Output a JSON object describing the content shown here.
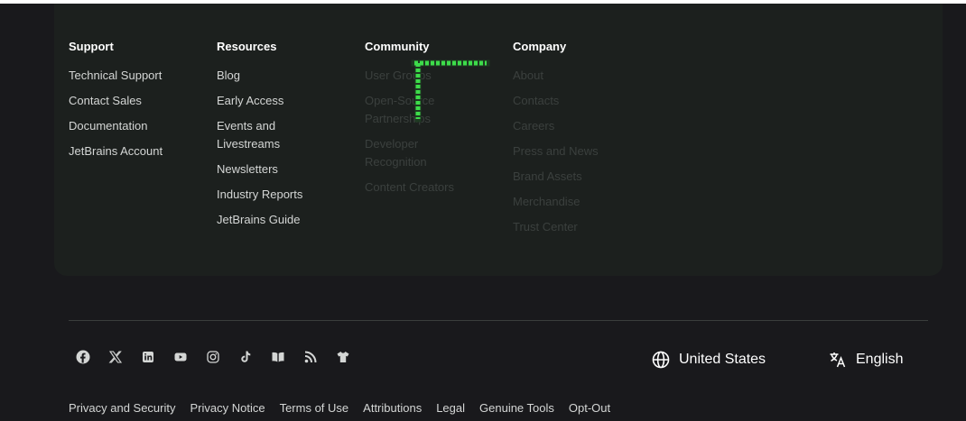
{
  "columns": {
    "support": {
      "title": "Support",
      "links": [
        "Technical Support",
        "Contact Sales",
        "Documentation",
        "JetBrains Account"
      ]
    },
    "resources": {
      "title": "Resources",
      "links": [
        "Blog",
        "Early Access",
        "Events and Livestreams",
        "Newsletters",
        "Industry Reports",
        "JetBrains Guide"
      ]
    },
    "community": {
      "title": "Community",
      "links": [
        "User Groups",
        "Open-Source Partnerships",
        "Developer Recognition",
        "Content Creators"
      ]
    },
    "company": {
      "title": "Company",
      "links": [
        "About",
        "Contacts",
        "Careers",
        "Press and News",
        "Brand Assets",
        "Merchandise",
        "Trust Center"
      ]
    }
  },
  "social_icons": [
    "facebook-icon",
    "x-icon",
    "linkedin-icon",
    "youtube-icon",
    "instagram-icon",
    "tiktok-icon",
    "book-icon",
    "rss-icon",
    "merch-shirt-icon"
  ],
  "region": {
    "label": "United States",
    "icon": "globe-icon"
  },
  "language": {
    "label": "English",
    "icon": "translate-icon"
  },
  "legal_links": [
    "Privacy and Security",
    "Privacy Notice",
    "Terms of Use",
    "Attributions",
    "Legal",
    "Genuine Tools",
    "Opt-Out"
  ],
  "colors": {
    "background": "#19191c",
    "panel": "#1c201e",
    "link": "#d4d6d5",
    "dim_link": "#3b403e",
    "overlay": "#3ddc4a"
  }
}
